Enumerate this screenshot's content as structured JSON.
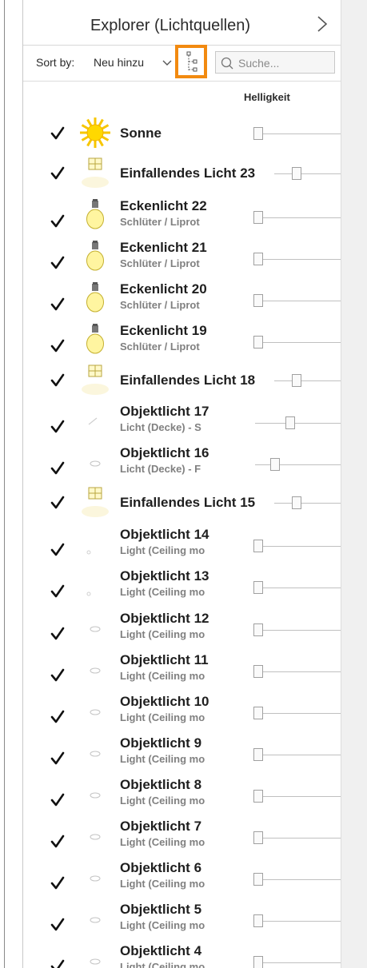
{
  "header": {
    "title": "Explorer (Lichtquellen)"
  },
  "toolbar": {
    "sort_label": "Sort by:",
    "sort_value": "Neu hinzu",
    "search_placeholder": "Suche..."
  },
  "columns": {
    "brightness": "Helligkeit"
  },
  "lights": [
    {
      "name": "Sonne",
      "sub": "",
      "icon": "sun-icon",
      "checked": true,
      "brightness": 0.0
    },
    {
      "name": "Einfallendes Licht 23",
      "sub": "",
      "icon": "window-light-icon",
      "checked": true,
      "brightness": 0.3
    },
    {
      "name": "Eckenlicht 22",
      "sub": "Schlüter / Liprot",
      "icon": "bulb-icon",
      "checked": true,
      "brightness": 0.0
    },
    {
      "name": "Eckenlicht 21",
      "sub": "Schlüter / Liprot",
      "icon": "bulb-icon",
      "checked": true,
      "brightness": 0.0
    },
    {
      "name": "Eckenlicht 20",
      "sub": "Schlüter / Liprot",
      "icon": "bulb-icon",
      "checked": true,
      "brightness": 0.0
    },
    {
      "name": "Eckenlicht 19",
      "sub": "Schlüter / Liprot",
      "icon": "bulb-icon",
      "checked": true,
      "brightness": 0.0
    },
    {
      "name": "Einfallendes Licht 18",
      "sub": "",
      "icon": "window-light-icon",
      "checked": true,
      "brightness": 0.3
    },
    {
      "name": "Objektlicht 17",
      "sub": "Licht (Decke) - S",
      "icon": "object-light-icon",
      "checked": true,
      "brightness": 0.4
    },
    {
      "name": "Objektlicht 16",
      "sub": "Licht (Decke) - F",
      "icon": "ceiling-light-icon",
      "checked": true,
      "brightness": 0.2
    },
    {
      "name": "Einfallendes Licht 15",
      "sub": "",
      "icon": "window-light-icon",
      "checked": true,
      "brightness": 0.3
    },
    {
      "name": "Objektlicht 14",
      "sub": "Light (Ceiling mo",
      "icon": "spot-light-icon",
      "checked": true,
      "brightness": 0.0
    },
    {
      "name": "Objektlicht 13",
      "sub": "Light (Ceiling mo",
      "icon": "spot-light-icon",
      "checked": true,
      "brightness": 0.0
    },
    {
      "name": "Objektlicht 12",
      "sub": "Light (Ceiling mo",
      "icon": "ceiling-light-icon",
      "checked": true,
      "brightness": 0.0
    },
    {
      "name": "Objektlicht 11",
      "sub": "Light (Ceiling mo",
      "icon": "ceiling-light-icon",
      "checked": true,
      "brightness": 0.0
    },
    {
      "name": "Objektlicht 10",
      "sub": "Light (Ceiling mo",
      "icon": "ceiling-light-icon",
      "checked": true,
      "brightness": 0.0
    },
    {
      "name": "Objektlicht 9",
      "sub": "Light (Ceiling mo",
      "icon": "ceiling-light-icon",
      "checked": true,
      "brightness": 0.0
    },
    {
      "name": "Objektlicht 8",
      "sub": "Light (Ceiling mo",
      "icon": "ceiling-light-icon",
      "checked": true,
      "brightness": 0.0
    },
    {
      "name": "Objektlicht 7",
      "sub": "Light (Ceiling mo",
      "icon": "ceiling-light-icon",
      "checked": true,
      "brightness": 0.0
    },
    {
      "name": "Objektlicht 6",
      "sub": "Light (Ceiling mo",
      "icon": "ceiling-light-icon",
      "checked": true,
      "brightness": 0.0
    },
    {
      "name": "Objektlicht 5",
      "sub": "Light (Ceiling mo",
      "icon": "ceiling-light-icon",
      "checked": true,
      "brightness": 0.0
    },
    {
      "name": "Objektlicht 4",
      "sub": "Light (Ceiling mo",
      "icon": "ceiling-light-icon",
      "checked": true,
      "brightness": 0.0
    }
  ],
  "colors": {
    "accent": "#f28a10",
    "text": "#1f1f1f",
    "subtext": "#808080",
    "scrollbar": "#f0f0f0"
  }
}
